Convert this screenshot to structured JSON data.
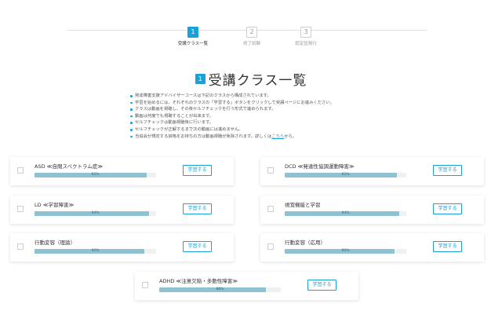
{
  "stepper": {
    "steps": [
      {
        "number": "1",
        "label": "受講クラス一覧"
      },
      {
        "number": "2",
        "label": "修了試験"
      },
      {
        "number": "3",
        "label": "認定証発行"
      }
    ]
  },
  "heading": {
    "number": "1",
    "title": "受講クラス一覧"
  },
  "notes": [
    "発達障害支援アドバイザーコースは下記のクラスから構成されています。",
    "学習を始めるには、それぞれのクラスの「学習する」ボタンをクリックして受講ページにお進みください。",
    "クラスは動画を視聴し、その後セルフチェックを行う形式で進められます。",
    "動画は何度でも視聴することが出来ます。",
    "セルフチェックは動画視聴後に行います。",
    "セルフチェックが正解するまで次の動画には進めません。"
  ],
  "last_note": {
    "before": "当協会が規定する資格をお持ちの方は動画視聴が免除されます。詳しくは",
    "link": "こちら",
    "after": "から。"
  },
  "colors": {
    "accent": "#1aa1d9",
    "progress_fill": "#8cc3d1"
  },
  "courses": [
    {
      "title": "ASD ≪自閉スペクトラム症≫",
      "progress": 92,
      "progress_label": "92%",
      "button": "学習する"
    },
    {
      "title": "DCD ≪発達性協調運動障害≫",
      "progress": 92,
      "progress_label": "92%",
      "button": "学習する"
    },
    {
      "title": "LD ≪学習障害≫",
      "progress": 94,
      "progress_label": "94%",
      "button": "学習する"
    },
    {
      "title": "視覚機能と学習",
      "progress": 94,
      "progress_label": "94%",
      "button": "学習する"
    },
    {
      "title": "行動変容（理論）",
      "progress": 90,
      "progress_label": "90%",
      "button": "学習する"
    },
    {
      "title": "行動変容（応用）",
      "progress": 90,
      "progress_label": "90%",
      "button": "学習する"
    },
    {
      "title": "ADHD ≪注意欠陥・多動性障害≫",
      "progress": 88,
      "progress_label": "88%",
      "button": "学習する"
    }
  ]
}
